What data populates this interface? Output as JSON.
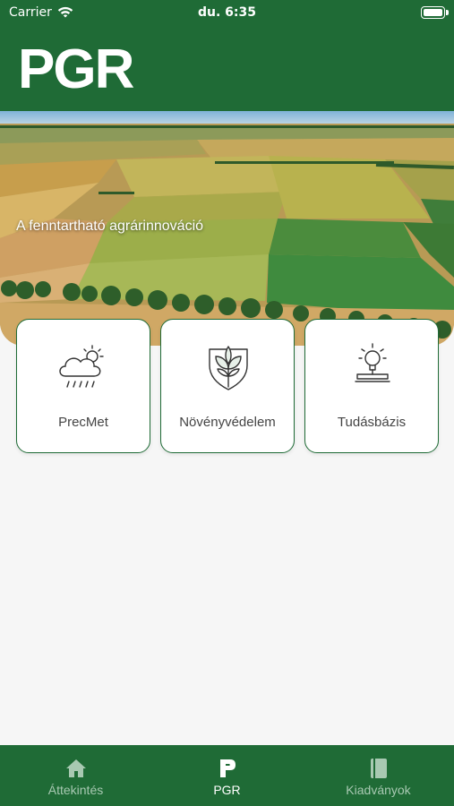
{
  "status_bar": {
    "carrier": "Carrier",
    "time": "du. 6:35",
    "icons": [
      "wifi-icon",
      "battery-icon"
    ]
  },
  "header": {
    "logo_text": "PGR"
  },
  "hero": {
    "tagline": "A fenntartható agrárinnováció"
  },
  "tiles": [
    {
      "label": "PrecMet",
      "icon": "weather-cloud-icon"
    },
    {
      "label": "Növényvédelem",
      "icon": "plant-shield-icon"
    },
    {
      "label": "Tudásbázis",
      "icon": "lightbulb-icon"
    }
  ],
  "tab_bar": {
    "items": [
      {
        "label": "Áttekintés",
        "icon": "home-icon",
        "active": false
      },
      {
        "label": "PGR",
        "icon": "pgr-logo-icon",
        "active": true
      },
      {
        "label": "Kiadványok",
        "icon": "book-icon",
        "active": false
      }
    ]
  },
  "colors": {
    "brand_green": "#1f6b36",
    "tab_inactive": "#a8c9b2",
    "tab_active": "#ffffff",
    "background": "#f6f6f6"
  }
}
